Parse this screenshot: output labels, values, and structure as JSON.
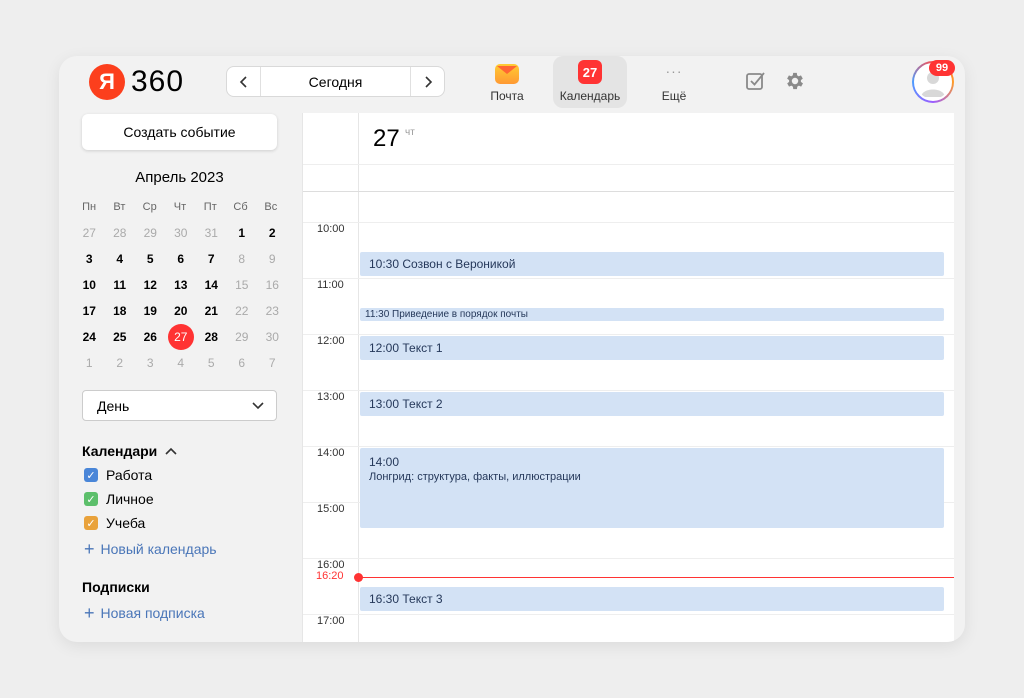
{
  "header": {
    "logo_letter": "Я",
    "logo_text": "360",
    "today_label": "Сегодня",
    "apps": [
      {
        "label": "Почта",
        "icon": "mail-icon"
      },
      {
        "label": "Календарь",
        "icon": "calendar-icon",
        "badge": "27",
        "active": true
      },
      {
        "label": "Ещё",
        "icon": "more-icon",
        "glyph": "···"
      }
    ],
    "notification_count": "99"
  },
  "sidebar": {
    "create_label": "Создать событие",
    "month_title": "Апрель 2023",
    "weekdays": [
      "Пн",
      "Вт",
      "Ср",
      "Чт",
      "Пт",
      "Сб",
      "Вс"
    ],
    "days": [
      {
        "n": "27",
        "muted": true
      },
      {
        "n": "28",
        "muted": true
      },
      {
        "n": "29",
        "muted": true
      },
      {
        "n": "30",
        "muted": true
      },
      {
        "n": "31",
        "muted": true
      },
      {
        "n": "1"
      },
      {
        "n": "2"
      },
      {
        "n": "3"
      },
      {
        "n": "4"
      },
      {
        "n": "5"
      },
      {
        "n": "6"
      },
      {
        "n": "7"
      },
      {
        "n": "8",
        "weekend": true
      },
      {
        "n": "9",
        "weekend": true
      },
      {
        "n": "10"
      },
      {
        "n": "11"
      },
      {
        "n": "12"
      },
      {
        "n": "13"
      },
      {
        "n": "14"
      },
      {
        "n": "15",
        "weekend": true
      },
      {
        "n": "16",
        "weekend": true
      },
      {
        "n": "17"
      },
      {
        "n": "18"
      },
      {
        "n": "19"
      },
      {
        "n": "20"
      },
      {
        "n": "21"
      },
      {
        "n": "22",
        "weekend": true
      },
      {
        "n": "23",
        "weekend": true
      },
      {
        "n": "24"
      },
      {
        "n": "25"
      },
      {
        "n": "26"
      },
      {
        "n": "27",
        "today": true
      },
      {
        "n": "28"
      },
      {
        "n": "29",
        "weekend": true
      },
      {
        "n": "30",
        "weekend": true
      },
      {
        "n": "1",
        "muted": true
      },
      {
        "n": "2",
        "muted": true
      },
      {
        "n": "3",
        "muted": true
      },
      {
        "n": "4",
        "muted": true
      },
      {
        "n": "5",
        "muted": true
      },
      {
        "n": "6",
        "muted": true
      },
      {
        "n": "7",
        "muted": true
      }
    ],
    "view_label": "День",
    "calendars_title": "Календари",
    "calendars": [
      {
        "label": "Работа",
        "color": "#4a86d8"
      },
      {
        "label": "Личное",
        "color": "#5cbf6b"
      },
      {
        "label": "Учеба",
        "color": "#e9a23b"
      }
    ],
    "new_calendar_label": "Новый календарь",
    "subscriptions_title": "Подписки",
    "new_subscription_label": "Новая подписка"
  },
  "main": {
    "day_number": "27",
    "day_of_week": "чт",
    "hours": [
      "10:00",
      "11:00",
      "12:00",
      "13:00",
      "14:00",
      "15:00",
      "16:00",
      "17:00"
    ],
    "now_label": "16:20",
    "events": [
      {
        "time": "10:30",
        "title": "10:30 Созвон с Вероникой"
      },
      {
        "time": "11:30",
        "title": "11:30 Приведение в порядок почты"
      },
      {
        "time": "12:00",
        "title": "12:00 Текст 1"
      },
      {
        "time": "13:00",
        "title": "13:00 Текст 2"
      },
      {
        "time": "14:00",
        "title": "14:00",
        "subtitle": "Лонгрид: структура, факты, иллюстрации"
      },
      {
        "time": "16:30",
        "title": "16:30 Текст 3"
      }
    ]
  }
}
